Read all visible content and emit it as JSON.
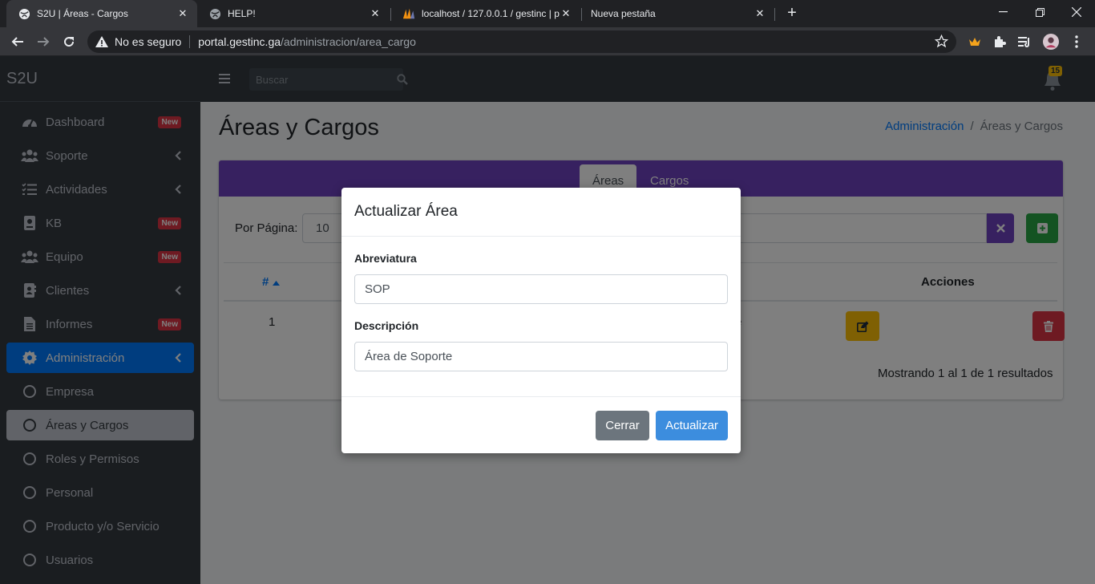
{
  "browser": {
    "tabs": [
      {
        "title": "S2U | Áreas - Cargos",
        "active": true
      },
      {
        "title": "HELP!",
        "active": false
      },
      {
        "title": "localhost / 127.0.0.1 / gestinc | ph",
        "active": false
      },
      {
        "title": "Nueva pestaña",
        "active": false
      }
    ],
    "security_label": "No es seguro",
    "url_host": "portal.gestinc.ga",
    "url_path": "/administracion/area_cargo"
  },
  "app": {
    "brand": "S2U",
    "search_placeholder": "Buscar",
    "notifications_count": "15"
  },
  "sidebar": {
    "items": [
      {
        "label": "Dashboard",
        "icon": "tachometer-icon",
        "badge": "New"
      },
      {
        "label": "Soporte",
        "icon": "users-icon",
        "chevron": true
      },
      {
        "label": "Actividades",
        "icon": "tasks-icon",
        "chevron": true
      },
      {
        "label": "KB",
        "icon": "book-icon",
        "badge": "New"
      },
      {
        "label": "Equipo",
        "icon": "users-icon",
        "badge": "New"
      },
      {
        "label": "Clientes",
        "icon": "address-book-icon",
        "chevron": true
      },
      {
        "label": "Informes",
        "icon": "file-icon",
        "badge": "New"
      },
      {
        "label": "Administración",
        "icon": "gear-icon",
        "chevron": true,
        "state": "active"
      },
      {
        "label": "Empresa",
        "icon": "circle-icon"
      },
      {
        "label": "Áreas y Cargos",
        "icon": "circle-icon",
        "state": "current"
      },
      {
        "label": "Roles y Permisos",
        "icon": "circle-icon"
      },
      {
        "label": "Personal",
        "icon": "circle-icon"
      },
      {
        "label": "Producto y/o Servicio",
        "icon": "circle-icon"
      },
      {
        "label": "Usuarios",
        "icon": "circle-icon"
      }
    ]
  },
  "page": {
    "title": "Áreas y Cargos",
    "breadcrumb": [
      "Administración",
      "Áreas y Cargos"
    ],
    "tabs": [
      "Áreas",
      "Cargos"
    ],
    "per_page_label": "Por Página:",
    "per_page_value": "10",
    "table": {
      "headers": [
        "#",
        "Acciones"
      ],
      "rows": [
        {
          "num": "1",
          "partial": "e"
        }
      ]
    },
    "results_text": "Mostrando 1 al 1 de 1 resultados"
  },
  "modal": {
    "title": "Actualizar Área",
    "abbr_label": "Abreviatura",
    "abbr_value": "SOP",
    "desc_label": "Descripción",
    "desc_value": "Área de Soporte",
    "close_label": "Cerrar",
    "update_label": "Actualizar"
  },
  "colors": {
    "sidebar": "#343a40",
    "primary": "#007bff",
    "card_header": "#6f42c1",
    "success": "#28a745",
    "warning": "#ffc107",
    "danger": "#dc3545"
  }
}
